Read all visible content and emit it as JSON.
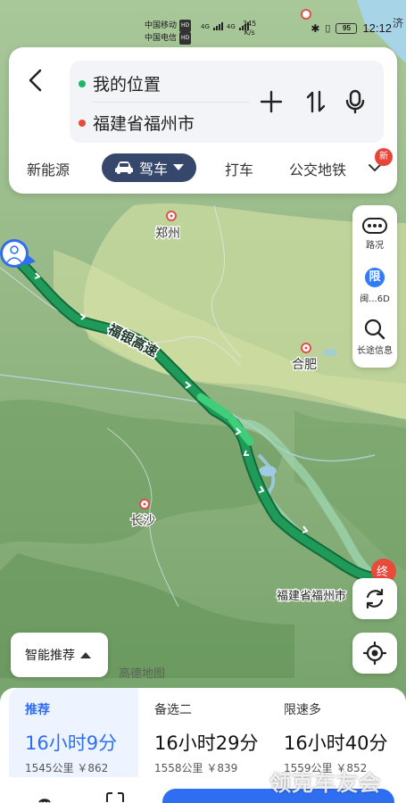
{
  "status": {
    "carrier1": "中国移动",
    "carrier2": "中国电信",
    "hd": "HD",
    "net": "4G",
    "speed_value": "345",
    "speed_unit": "K/s",
    "battery": "95",
    "time": "12:12"
  },
  "search": {
    "origin": "我的位置",
    "destination": "福建省福州市"
  },
  "modes": [
    {
      "label": "新能源"
    },
    {
      "label": "驾车",
      "selected": true
    },
    {
      "label": "打车"
    },
    {
      "label": "公交地铁"
    }
  ],
  "new_badge": "新",
  "map": {
    "cities": {
      "zhengzhou": "郑州",
      "hefei": "合肥",
      "changsha": "长沙",
      "fuzhou": "福建省福州市"
    },
    "road_label": "福银高速",
    "partial_label": "济",
    "dest_marker": "终"
  },
  "right_panel": {
    "traffic_label": "路况",
    "limit_icon": "限",
    "limit_label": "闽...6D",
    "longtrip_label": "长途信息"
  },
  "smart_recommend": "智能推荐",
  "amap_logo": "高德地图",
  "routes": [
    {
      "label": "推荐",
      "time": "16小时9分",
      "meta": "1545公里 ￥862"
    },
    {
      "label": "备选二",
      "time": "16小时29分",
      "meta": "1558公里 ￥839"
    },
    {
      "label": "限速多",
      "time": "16小时40分",
      "meta": "1559公里 ￥852"
    }
  ],
  "watermark": "领克车友会",
  "colors": {
    "accent": "#2f6ef0",
    "route": "#1a8a50",
    "drive_mode_bg": "#35486b"
  }
}
